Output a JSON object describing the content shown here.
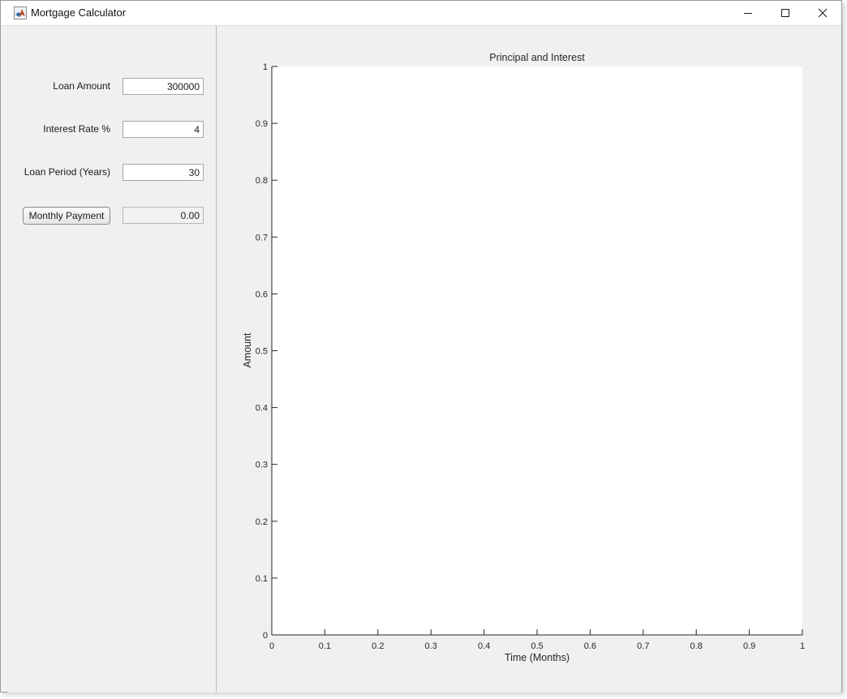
{
  "window": {
    "title": "Mortgage Calculator",
    "icon": "matlab-icon",
    "controls": [
      "minimize-icon",
      "maximize-icon",
      "close-icon"
    ]
  },
  "form": {
    "loan_amount_label": "Loan Amount",
    "loan_amount_value": "300000",
    "interest_rate_label": "Interest Rate %",
    "interest_rate_value": "4",
    "loan_period_label": "Loan Period (Years)",
    "loan_period_value": "30",
    "monthly_payment_button": "Monthly Payment",
    "monthly_payment_value": "0.00"
  },
  "chart_data": {
    "type": "line",
    "title": "Principal and Interest",
    "xlabel": "Time (Months)",
    "ylabel": "Amount",
    "xlim": [
      0,
      1
    ],
    "ylim": [
      0,
      1
    ],
    "xticks": [
      "0",
      "0.1",
      "0.2",
      "0.3",
      "0.4",
      "0.5",
      "0.6",
      "0.7",
      "0.8",
      "0.9",
      "1"
    ],
    "yticks": [
      "0",
      "0.1",
      "0.2",
      "0.3",
      "0.4",
      "0.5",
      "0.6",
      "0.7",
      "0.8",
      "0.9",
      "1"
    ],
    "series": [],
    "grid": false
  }
}
